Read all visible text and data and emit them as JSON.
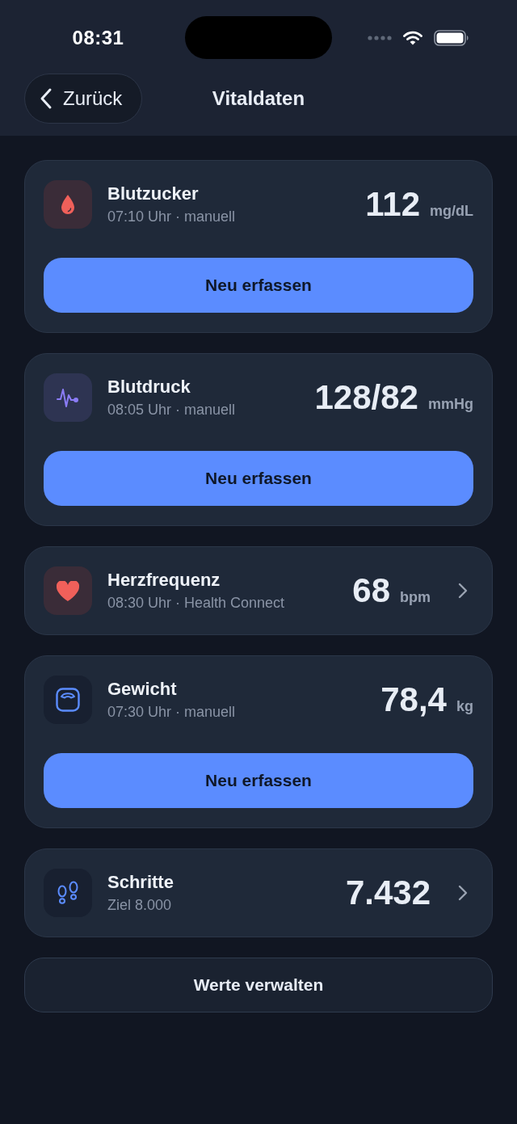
{
  "status_bar": {
    "time": "08:31"
  },
  "nav": {
    "back": "Zurück",
    "title": "Vitaldaten"
  },
  "vitals": [
    {
      "kind": "glucose",
      "title": "Blutzucker",
      "subtitle": "07:10 Uhr · manuell",
      "value": "112",
      "unit": "mg/dL",
      "action": "Neu erfassen",
      "chevron": false
    },
    {
      "kind": "blood_pressure",
      "title": "Blutdruck",
      "subtitle": "08:05 Uhr · manuell",
      "value": "128/82",
      "unit": "mmHg",
      "action": "Neu erfassen",
      "chevron": false
    },
    {
      "kind": "heart_rate",
      "title": "Herzfrequenz",
      "subtitle": "08:30 Uhr · Health Connect",
      "value": "68",
      "unit": "bpm",
      "chevron": true
    },
    {
      "kind": "weight",
      "title": "Gewicht",
      "subtitle": "07:30 Uhr · manuell",
      "value": "78,4",
      "unit": "kg",
      "action": "Neu erfassen",
      "chevron": false
    },
    {
      "kind": "steps",
      "title": "Schritte",
      "subtitle": "Ziel 8.000",
      "value": "7.432",
      "chevron": true
    }
  ],
  "manage_button": "Werte verwalten"
}
